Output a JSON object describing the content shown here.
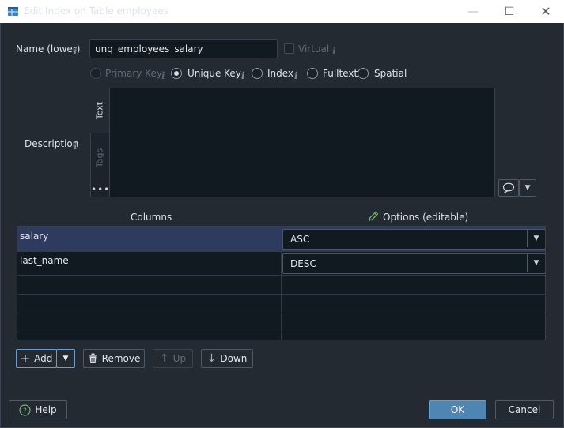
{
  "window": {
    "title": "Edit Index on Table employees",
    "minimize_glyph": "—",
    "maximize_glyph": "☐",
    "close_glyph": "✕"
  },
  "form": {
    "name_label": "Name (lower)",
    "name_value": "unq_employees_salary",
    "virtual_label": "Virtual",
    "info_glyph": "i",
    "index_types": [
      "Primary Key",
      "Unique Key",
      "Index",
      "Fulltext",
      "Spatial"
    ],
    "selected_index_type": "Unique Key",
    "description_label": "Description",
    "description_tabs": [
      "Text",
      "Tags"
    ],
    "more_glyph": "•••"
  },
  "grid": {
    "col_columns": "Columns",
    "col_options": "Options (editable)",
    "rows": [
      {
        "column": "salary",
        "option": "ASC",
        "selected": true
      },
      {
        "column": "last_name",
        "option": "DESC",
        "selected": false
      }
    ]
  },
  "buttons": {
    "add": "Add",
    "remove": "Remove",
    "up": "Up",
    "down": "Down",
    "help": "Help",
    "ok": "OK",
    "cancel": "Cancel"
  },
  "icons": {
    "app": "database-table-icon",
    "info": "info-icon",
    "comment": "speech-bubble-icon",
    "dropdown": "chevron-down-icon",
    "pencil": "pencil-icon",
    "plus": "plus-icon",
    "trash": "trash-icon",
    "arrow_up": "arrow-up-icon",
    "arrow_down": "arrow-down-icon",
    "help": "question-circle-icon"
  },
  "colors": {
    "background": "#232a31",
    "field": "#121a21",
    "selection": "#2f3b5e",
    "accent": "#4e85b3"
  }
}
